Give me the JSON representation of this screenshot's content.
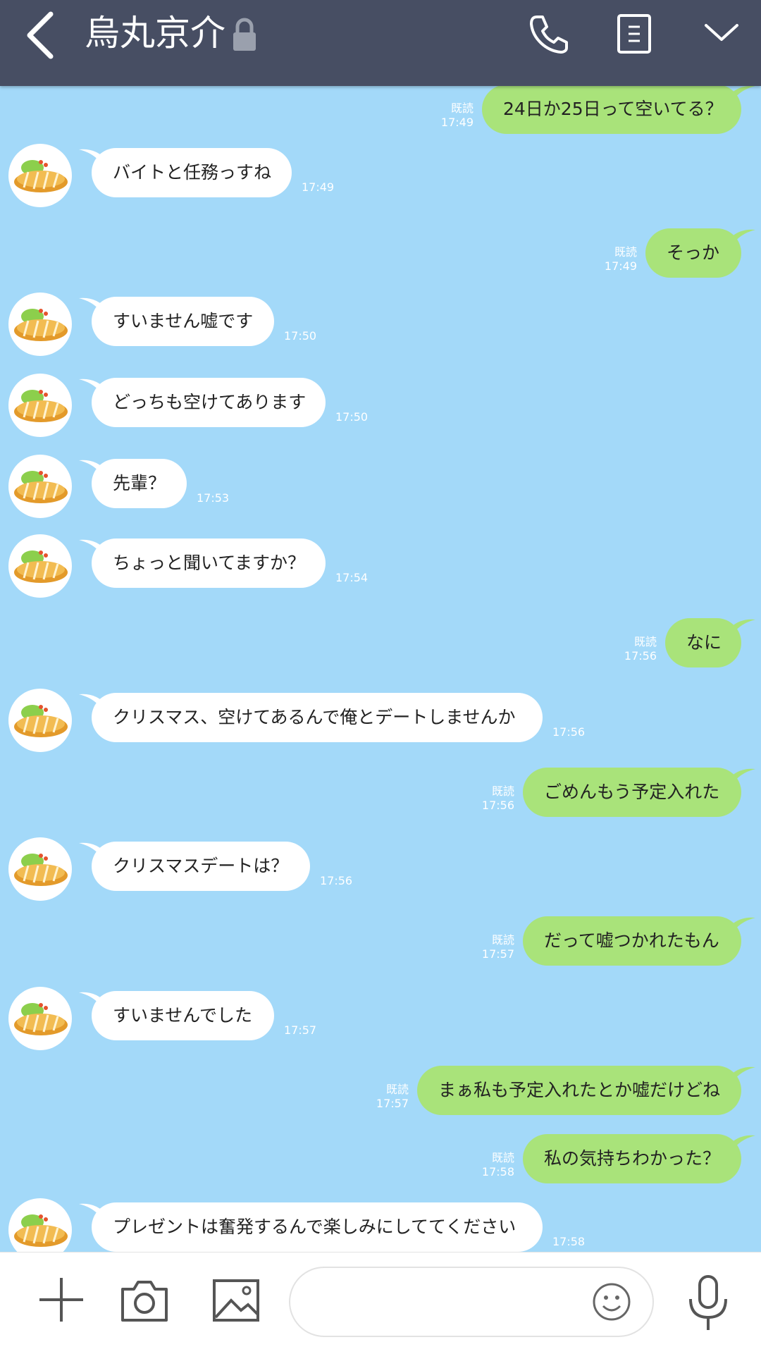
{
  "header": {
    "title": "烏丸京介"
  },
  "messages": [
    {
      "side": "out",
      "text": "24日か25日って空いてる？",
      "time": "17:49",
      "read": "既読"
    },
    {
      "side": "in",
      "text": "バイトと任務っすね",
      "time": "17:49"
    },
    {
      "side": "out",
      "text": "そっか",
      "time": "17:49",
      "read": "既読"
    },
    {
      "side": "in",
      "text": "すいません嘘です",
      "time": "17:50"
    },
    {
      "side": "in",
      "text": "どっちも空けてあります",
      "time": "17:50"
    },
    {
      "side": "in",
      "text": "先輩？",
      "time": "17:53"
    },
    {
      "side": "in",
      "text": "ちょっと聞いてますか？",
      "time": "17:54"
    },
    {
      "side": "out",
      "text": "なに",
      "time": "17:56",
      "read": "既読"
    },
    {
      "side": "in",
      "text": "クリスマス、空けてあるんで俺とデートしませんか",
      "time": "17:56"
    },
    {
      "side": "out",
      "text": "ごめんもう予定入れた",
      "time": "17:56",
      "read": "既読"
    },
    {
      "side": "in",
      "text": "クリスマスデートは？",
      "time": "17:56"
    },
    {
      "side": "out",
      "text": "だって嘘つかれたもん",
      "time": "17:57",
      "read": "既読"
    },
    {
      "side": "in",
      "text": "すいませんでした",
      "time": "17:57"
    },
    {
      "side": "out",
      "text": "まぁ私も予定入れたとか嘘だけどね",
      "time": "17:57",
      "read": "既読"
    },
    {
      "side": "out",
      "text": "私の気持ちわかった？",
      "time": "17:58",
      "read": "既読"
    },
    {
      "side": "in",
      "text": "プレゼントは奮発するんで楽しみにしててください",
      "time": "17:58"
    }
  ],
  "colors": {
    "header_bg": "#474e63",
    "chat_bg": "#a3d9f9",
    "out_bubble": "#a9e37a",
    "in_bubble": "#ffffff"
  },
  "icons": {
    "back": "chevron-left-icon",
    "lock": "lock-icon",
    "call": "phone-icon",
    "notes": "notes-icon",
    "menu": "chevron-down-icon",
    "add": "plus-icon",
    "camera": "camera-icon",
    "image": "image-icon",
    "emoji": "emoji-icon",
    "mic": "microphone-icon"
  }
}
